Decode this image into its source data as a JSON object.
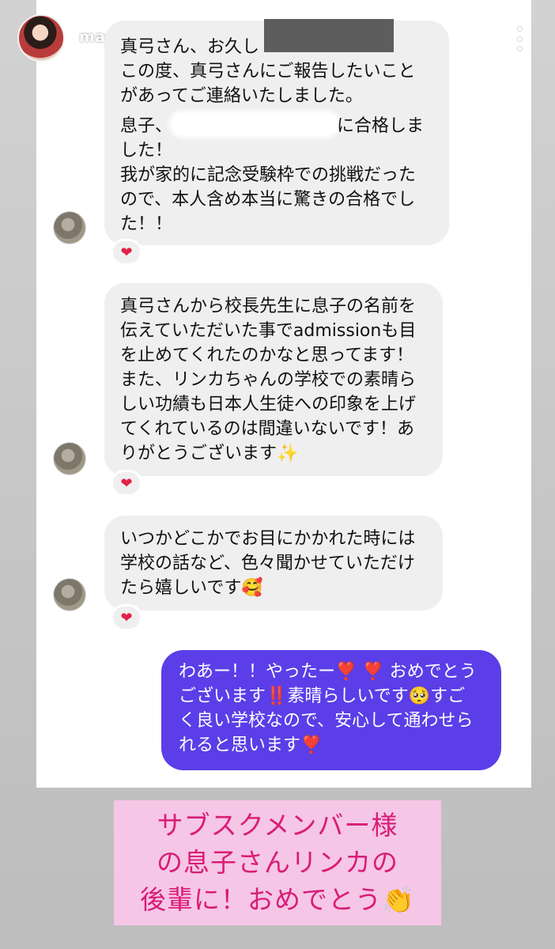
{
  "header": {
    "username": "mayumikawamura",
    "more_icon": "more-vertical-icon"
  },
  "messages": [
    {
      "lines": [
        "真弓さん、お久し",
        "この度、真弓さんにご報告したいこと",
        "があってご連絡いたしました。",
        "息子、",
        "に合格しま",
        "した！",
        "我が家的に記念受験枠での挑戦だった",
        "ので、本人含め本当に驚きの合格でし",
        "た！！"
      ],
      "reaction": "❤"
    },
    {
      "lines": [
        "真弓さんから校長先生に息子の名前を",
        "伝えていただいた事でadmissionも目",
        "を止めてくれたのかなと思ってます！",
        "また、リンカちゃんの学校での素晴ら",
        "しい功績も日本人生徒への印象を上げ",
        "てくれているのは間違いないです！あ",
        "りがとうございます✨"
      ],
      "reaction": "❤"
    },
    {
      "lines": [
        "いつかどこかでお目にかかれた時には",
        "学校の話など、色々聞かせていただけ",
        "たら嬉しいです🥰"
      ],
      "reaction": "❤"
    }
  ],
  "reply": {
    "lines": [
      "わあー！！やったー❣️ ❣️ おめでとう",
      "ございます‼️素晴らしいです🥺すご",
      "く良い学校なので、安心して通わせら",
      "れると思います❣️"
    ]
  },
  "sticker": {
    "lines": [
      "サブスクメンバー様",
      "の息子さんリンカの",
      "後輩に！おめでとう👏"
    ]
  },
  "colors": {
    "outgoing_bubble": "#5b3ee8",
    "incoming_bubble": "#efefef",
    "sticker_bg": "#f6c6e6",
    "sticker_text": "#d81d77",
    "heart": "#e0224a"
  }
}
